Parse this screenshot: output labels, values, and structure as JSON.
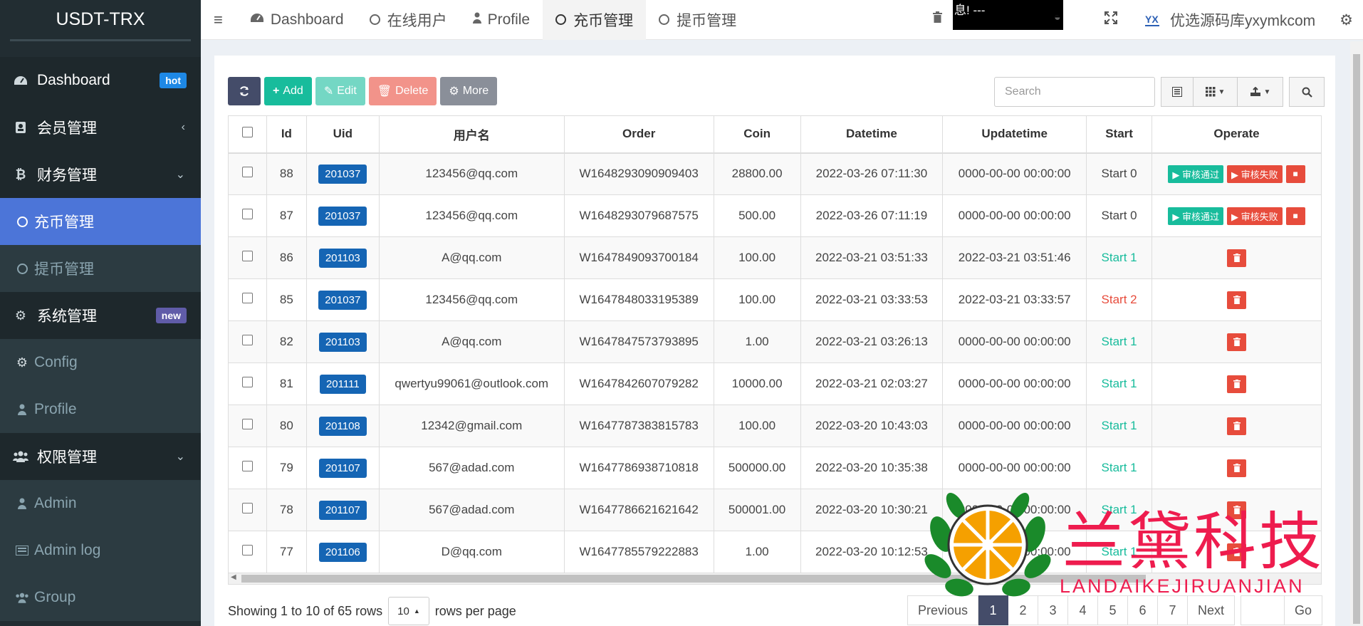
{
  "brand": "USDT-TRX",
  "sidebar": {
    "items": [
      {
        "label": "Dashboard",
        "icon": "dashboard-icon",
        "badge": "hot"
      },
      {
        "label": "会员管理",
        "icon": "user-icon"
      },
      {
        "label": "财务管理",
        "icon": "bitcoin-icon"
      },
      {
        "label": "充币管理",
        "icon": "circle-icon"
      },
      {
        "label": "提币管理",
        "icon": "circle-icon"
      },
      {
        "label": "系统管理",
        "icon": "cogs-icon",
        "badge": "new"
      },
      {
        "label": "Config",
        "icon": "gear-icon"
      },
      {
        "label": "Profile",
        "icon": "user-icon"
      },
      {
        "label": "权限管理",
        "icon": "group-icon"
      },
      {
        "label": "Admin",
        "icon": "user-icon"
      },
      {
        "label": "Admin log",
        "icon": "list-icon"
      },
      {
        "label": "Group",
        "icon": "group-icon"
      }
    ]
  },
  "topnav": {
    "tabs": [
      {
        "label": "Dashboard"
      },
      {
        "label": "在线用户"
      },
      {
        "label": "Profile"
      },
      {
        "label": "充币管理"
      },
      {
        "label": "提币管理"
      }
    ],
    "notice": "息! ---",
    "site_name": "优选源码库yxymkcom"
  },
  "toolbar": {
    "add": "Add",
    "edit": "Edit",
    "delete": "Delete",
    "more": "More",
    "search_placeholder": "Search"
  },
  "table": {
    "headers": [
      "Id",
      "Uid",
      "用户名",
      "Order",
      "Coin",
      "Datetime",
      "Updatetime",
      "Start",
      "Operate"
    ],
    "approve_label": "审核通过",
    "reject_label": "审核失败",
    "rows": [
      {
        "id": "88",
        "uid": "201037",
        "user": "123456@qq.com",
        "order": "W1648293090909403",
        "coin": "28800.00",
        "datetime": "2022-03-26 07:11:30",
        "updatetime": "0000-00-00 00:00:00",
        "start": "Start 0"
      },
      {
        "id": "87",
        "uid": "201037",
        "user": "123456@qq.com",
        "order": "W1648293079687575",
        "coin": "500.00",
        "datetime": "2022-03-26 07:11:19",
        "updatetime": "0000-00-00 00:00:00",
        "start": "Start 0"
      },
      {
        "id": "86",
        "uid": "201103",
        "user": "A@qq.com",
        "order": "W1647849093700184",
        "coin": "100.00",
        "datetime": "2022-03-21 03:51:33",
        "updatetime": "2022-03-21 03:51:46",
        "start": "Start 1"
      },
      {
        "id": "85",
        "uid": "201037",
        "user": "123456@qq.com",
        "order": "W1647848033195389",
        "coin": "100.00",
        "datetime": "2022-03-21 03:33:53",
        "updatetime": "2022-03-21 03:33:57",
        "start": "Start 2"
      },
      {
        "id": "82",
        "uid": "201103",
        "user": "A@qq.com",
        "order": "W1647847573793895",
        "coin": "1.00",
        "datetime": "2022-03-21 03:26:13",
        "updatetime": "0000-00-00 00:00:00",
        "start": "Start 1"
      },
      {
        "id": "81",
        "uid": "201111",
        "user": "qwertyu99061@outlook.com",
        "order": "W1647842607079282",
        "coin": "10000.00",
        "datetime": "2022-03-21 02:03:27",
        "updatetime": "0000-00-00 00:00:00",
        "start": "Start 1"
      },
      {
        "id": "80",
        "uid": "201108",
        "user": "12342@gmail.com",
        "order": "W1647787383815783",
        "coin": "100.00",
        "datetime": "2022-03-20 10:43:03",
        "updatetime": "0000-00-00 00:00:00",
        "start": "Start 1"
      },
      {
        "id": "79",
        "uid": "201107",
        "user": "567@adad.com",
        "order": "W1647786938710818",
        "coin": "500000.00",
        "datetime": "2022-03-20 10:35:38",
        "updatetime": "0000-00-00 00:00:00",
        "start": "Start 1"
      },
      {
        "id": "78",
        "uid": "201107",
        "user": "567@adad.com",
        "order": "W1647786621621642",
        "coin": "500001.00",
        "datetime": "2022-03-20 10:30:21",
        "updatetime": "0000-00-00 00:00:00",
        "start": "Start 1"
      },
      {
        "id": "77",
        "uid": "201106",
        "user": "D@qq.com",
        "order": "W1647785579222883",
        "coin": "1.00",
        "datetime": "2022-03-20 10:12:53",
        "updatetime": "0000-00-00 00:00:00",
        "start": "Start 1"
      }
    ]
  },
  "footer": {
    "showing": "Showing 1 to 10 of 65 rows",
    "page_size": "10",
    "rows_per_page": "rows per page",
    "previous": "Previous",
    "pages": [
      "1",
      "2",
      "3",
      "4",
      "5",
      "6",
      "7"
    ],
    "next": "Next",
    "go": "Go"
  },
  "watermark": {
    "cn": "兰黛科技",
    "en": "LANDAIKEJIRUANJIAN"
  },
  "colors": {
    "sidebar_bg": "#222d32",
    "active": "#4c75d8",
    "green": "#18bc9c",
    "red": "#e74c3c",
    "uid_badge": "#1565b4"
  }
}
